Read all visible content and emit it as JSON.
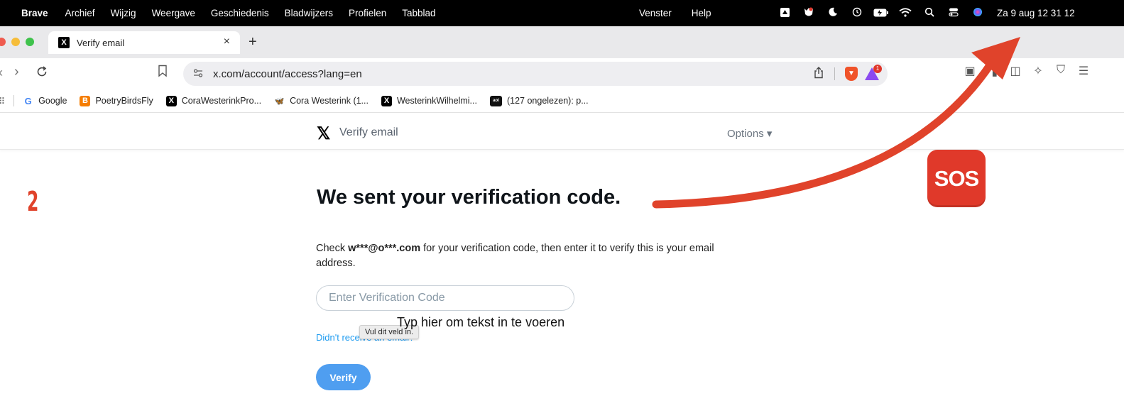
{
  "menubar": {
    "apple": "",
    "app_name": "Brave",
    "items": [
      "Archief",
      "Wijzig",
      "Weergave",
      "Geschiedenis",
      "Bladwijzers",
      "Profielen",
      "Tabblad"
    ],
    "right_items": [
      "Venster",
      "Help"
    ],
    "status_icons": [
      "drive-icon",
      "shield-app-icon",
      "moon-icon",
      "clock-icon",
      "battery-icon",
      "wifi-icon",
      "search-icon",
      "control-center-icon",
      "siri-icon"
    ],
    "clock": "Za 9 aug  12 31 12"
  },
  "tab": {
    "title": "Verify email",
    "close": "×",
    "new": "+"
  },
  "toolbar": {
    "back": "‹",
    "forward": "›",
    "reload": "C",
    "url": "x.com/account/access?lang=en",
    "share": "⇪",
    "rewards_badge": "1"
  },
  "bookmarks": [
    {
      "label": "Google",
      "icon": "G"
    },
    {
      "label": "PoetryBirdsFly",
      "icon": "B"
    },
    {
      "label": "CoraWesterinkPro...",
      "icon": "X"
    },
    {
      "label": "Cora Westerink (1...",
      "icon": "🦋"
    },
    {
      "label": "WesterinkWilhelmi...",
      "icon": "X"
    },
    {
      "label": "(127 ongelezen): p...",
      "icon": "aol"
    }
  ],
  "page_header": {
    "logo": "𝕏",
    "title": "Verify email",
    "options": "Options ▾"
  },
  "annotation": {
    "step": "2",
    "sos": "SOS",
    "arrow_color": "#e0432b"
  },
  "content": {
    "heading": "We sent your verification code.",
    "desc_prefix": "Check ",
    "email": "w***@o***.com",
    "desc_suffix": " for your verification code, then enter it to verify this is your email address.",
    "input_placeholder": "Enter Verification Code",
    "typing_hint": "Typ hier om tekst in te voeren",
    "resend_link": "Didn't receive an email?",
    "tooltip": "Vul dit veld in.",
    "verify_button": "Verify"
  }
}
